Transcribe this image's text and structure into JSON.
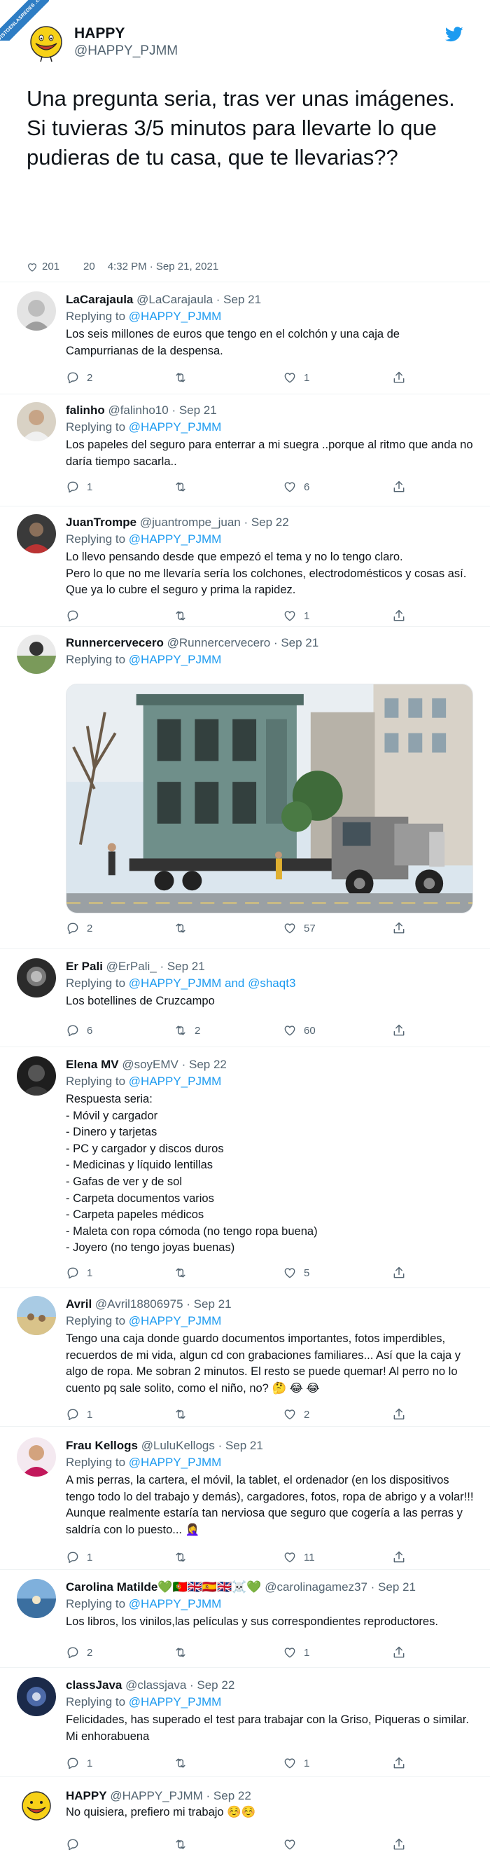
{
  "watermark": {
    "text": "VISTOENLASREDES .com"
  },
  "main_tweet": {
    "display_name": "HAPPY",
    "handle": "@HAPPY_PJMM",
    "text": "Una pregunta seria, tras ver unas imágenes.\nSi tuvieras 3/5 minutos para llevarte lo que pudieras de tu casa, que te llevarias??",
    "likes": "201",
    "replies": "20",
    "timestamp": "4:32 PM · Sep 21, 2021"
  },
  "replies": [
    {
      "name": "LaCarajaula",
      "handle": "@LaCarajaula · Sep 21",
      "replying_prefix": "Replying to ",
      "replying_to": "@HAPPY_PJMM",
      "text": "Los seis millones de euros que tengo en el colchón y una caja de Campurrianas de la despensa.",
      "reply_count": "2",
      "retweet_count": "",
      "like_count": "1"
    },
    {
      "name": "falinho",
      "handle": "@falinho10 · Sep 21",
      "replying_prefix": "Replying to ",
      "replying_to": "@HAPPY_PJMM",
      "text": "Los papeles del seguro para enterrar a mi suegra ..porque al ritmo que anda no daría tiempo sacarla..",
      "reply_count": "1",
      "retweet_count": "",
      "like_count": "6"
    },
    {
      "name": "JuanTrompe",
      "handle": "@juantrompe_juan · Sep 22",
      "replying_prefix": "Replying to ",
      "replying_to": "@HAPPY_PJMM",
      "text": "Lo llevo pensando desde que empezó el tema y no lo tengo claro.\nPero lo que no me llevaría sería los colchones, electrodomésticos y cosas así. Que ya lo cubre el seguro y prima la rapidez.",
      "reply_count": "",
      "retweet_count": "",
      "like_count": "1"
    },
    {
      "name": "Runnercervecero",
      "handle": "@Runnercervecero · Sep 21",
      "replying_prefix": "Replying to ",
      "replying_to": "@HAPPY_PJMM",
      "text": "",
      "reply_count": "2",
      "retweet_count": "",
      "like_count": "57"
    },
    {
      "name": "Er Pali",
      "handle": "@ErPali_ · Sep 21",
      "replying_prefix": "Replying to ",
      "replying_to": "@HAPPY_PJMM and @shaqt3",
      "text": "Los botellines de Cruzcampo",
      "reply_count": "6",
      "retweet_count": "2",
      "like_count": "60"
    },
    {
      "name": "Elena MV",
      "handle": "@soyEMV · Sep 22",
      "replying_prefix": "Replying to ",
      "replying_to": "@HAPPY_PJMM",
      "text": "Respuesta seria:\n- Móvil y cargador\n- Dinero y tarjetas\n- PC y cargador y discos duros\n- Medicinas y líquido lentillas\n- Gafas de ver y de sol\n- Carpeta documentos varios\n- Carpeta papeles médicos\n- Maleta con ropa cómoda (no tengo ropa buena)\n- Joyero (no tengo joyas buenas)",
      "reply_count": "1",
      "retweet_count": "",
      "like_count": "5"
    },
    {
      "name": "Avril",
      "handle": "@Avril18806975 · Sep 21",
      "replying_prefix": "Replying to ",
      "replying_to": "@HAPPY_PJMM",
      "text": "Tengo una caja donde guardo documentos importantes, fotos imperdibles, recuerdos de mi vida, algun cd con grabaciones familiares... Así que la caja y algo de ropa. Me sobran 2 minutos. El resto se puede quemar! Al perro no lo cuento pq sale solito, como el niño, no? 🤔 😂 😂",
      "reply_count": "1",
      "retweet_count": "",
      "like_count": "2"
    },
    {
      "name": "Frau Kellogs",
      "handle": "@LuluKellogs · Sep 21",
      "replying_prefix": "Replying to ",
      "replying_to": "@HAPPY_PJMM",
      "text": "A mis perras, la cartera, el móvil, la tablet, el ordenador (en los dispositivos tengo todo lo del trabajo y demás), cargadores, fotos, ropa de abrigo y a volar!!! Aunque realmente estaría tan nerviosa que seguro que cogería a las perras y saldría con lo puesto... 🤦‍♀️",
      "reply_count": "1",
      "retweet_count": "",
      "like_count": "11"
    },
    {
      "name": "Carolina Matilde💚🇵🇹🇬🇧🇪🇸🇬🇧☠️💚",
      "handle": "@carolinagamez37 · Sep 21",
      "replying_prefix": "Replying to ",
      "replying_to": "@HAPPY_PJMM",
      "text": "Los libros, los vinilos,las películas y sus correspondientes reproductores.",
      "reply_count": "2",
      "retweet_count": "",
      "like_count": "1"
    },
    {
      "name": "classJava",
      "handle": "@classjava · Sep 22",
      "replying_prefix": "Replying to ",
      "replying_to": "@HAPPY_PJMM",
      "text": "Felicidades, has superado el test para trabajar con la Griso, Piqueras o similar. Mi enhorabuena",
      "reply_count": "1",
      "retweet_count": "",
      "like_count": "1"
    },
    {
      "name": "HAPPY",
      "handle": "@HAPPY_PJMM · Sep 22",
      "replying_prefix": "",
      "replying_to": "",
      "text": "No quisiera, prefiero mi trabajo ☺️☺️",
      "reply_count": "",
      "retweet_count": "",
      "like_count": ""
    }
  ],
  "colors": {
    "link": "#1d9bf0",
    "muted": "#536471",
    "text": "#0f1419",
    "brand": "#1d9bf0"
  }
}
